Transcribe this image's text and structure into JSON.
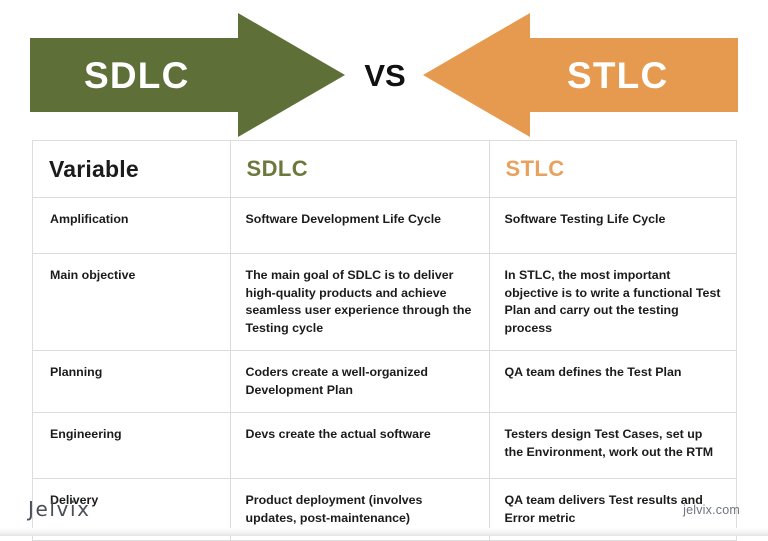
{
  "banner": {
    "left_arrow_label": "SDLC",
    "right_arrow_label": "STLC",
    "vs_label": "VS",
    "left_arrow_color": "#5f6f38",
    "right_arrow_color": "#e69a4f",
    "vs_color": "#111111"
  },
  "table": {
    "headers": {
      "variable": "Variable",
      "sdlc": "SDLC",
      "stlc": "STLC"
    },
    "header_colors": {
      "variable": "#1b1b1b",
      "sdlc": "#6b7a3c",
      "stlc": "#e8a15e"
    },
    "rows": [
      {
        "variable": "Amplification",
        "sdlc": "Software Development Life Cycle",
        "stlc": "Software Testing Life Cycle"
      },
      {
        "variable": "Main objective",
        "sdlc": "The main goal of SDLC is to deliver high-quality products and achieve seamless user experience through the Testing cycle",
        "stlc": "In STLC, the most important objective is to write a functional Test Plan and carry out the testing process"
      },
      {
        "variable": "Planning",
        "sdlc": "Coders create a well-organized Development Plan",
        "stlc": "QA team defines the Test Plan"
      },
      {
        "variable": "Engineering",
        "sdlc": "Devs create the actual software",
        "stlc": "Testers design Test Cases, set up the Environment, work out the RTM"
      },
      {
        "variable": "Delivery",
        "sdlc": "Product deployment (involves updates, post-maintenance)",
        "stlc": "QA team delivers Test results and Error metric"
      }
    ]
  },
  "footer": {
    "logo_text": "Jelvix",
    "website": "jelvix.com"
  }
}
